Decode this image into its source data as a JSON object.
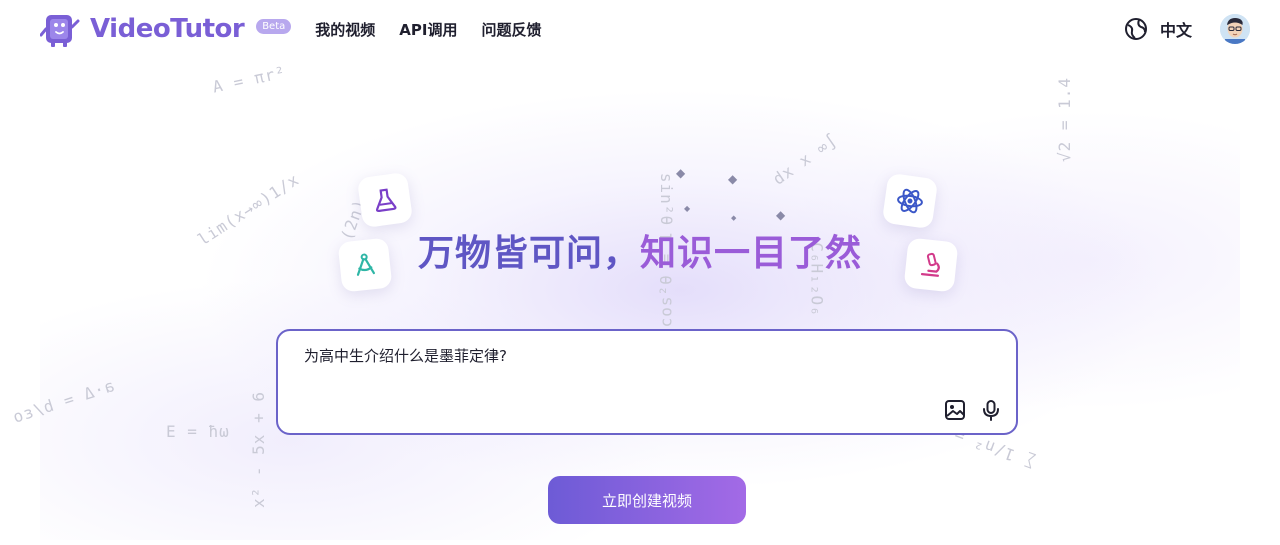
{
  "brand": {
    "name": "VideoTutor",
    "badge": "Beta"
  },
  "nav": {
    "items": [
      {
        "label": "我的视频"
      },
      {
        "label": "API调用"
      },
      {
        "label": "问题反馈"
      }
    ]
  },
  "header_right": {
    "language_label": "中文",
    "language_icon": "globe-icon",
    "avatar": "user-avatar"
  },
  "hero": {
    "title_part1": "万物皆可问，",
    "title_part2": "知识一目了然",
    "title_colors": [
      "#5f56c4",
      "#9a5cd8"
    ],
    "tiles": [
      "flask-icon",
      "compass-icon",
      "atom-icon",
      "microscope-icon"
    ]
  },
  "prompt": {
    "value": "为高中生介绍什么是墨菲定律?",
    "tools": [
      "image-upload-icon",
      "microphone-icon"
    ]
  },
  "cta": {
    "label": "立即创建视频",
    "gradient": [
      "#6d5bd6",
      "#a36ae6"
    ]
  },
  "background_formulas": [
    "A = πr²",
    "lim(x→∞)1/x",
    "(2n)",
    "sin²θ",
    "cos²θ = 1",
    "dx x ∞∫",
    "√2 = 1.4",
    "C₆H₁₂O₆",
    "E = ħω",
    "x² - 5x + 6",
    "a·Δ = b/εο",
    "∑ 1/n² = π²/6"
  ]
}
